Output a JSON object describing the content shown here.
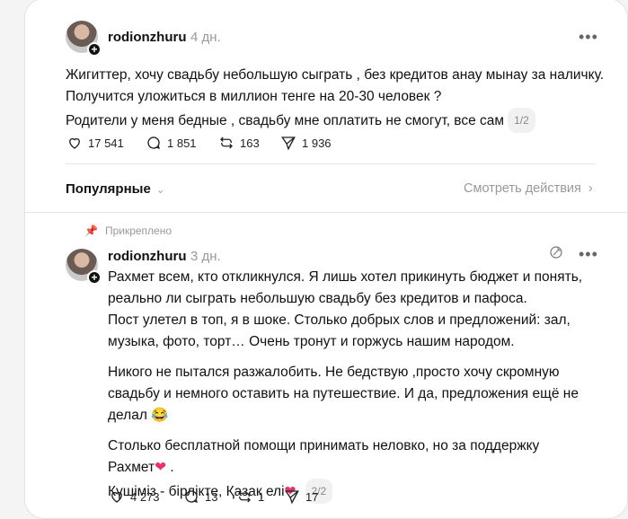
{
  "post": {
    "username": "rodionzhuru",
    "time": "4 дн.",
    "lines": [
      "Жигиттер, хочу свадьбу небольшую сыграть , без кредитов анау мынау за наличку.",
      "Получится уложиться в миллион тенге на 20-30 человек ?",
      "Родители у меня бедные , свадьбу мне оплатить не смогут, все сам"
    ],
    "page": "1/2",
    "likes": "17 541",
    "comments": "1 851",
    "reposts": "163",
    "shares": "1 936",
    "more": "•••"
  },
  "sort": {
    "label": "Популярные",
    "activity_link": "Смотреть действия"
  },
  "reply": {
    "pinned_label": "Прикреплено",
    "username": "rodionzhuru",
    "time": "3 дн.",
    "para1": [
      "Рахмет всем, кто откликнулся. Я лишь хотел прикинуть бюджет и понять,",
      "реально ли сыграть небольшую свадьбу без кредитов и пафоса.",
      "Пост улетел в топ, я в шоке. Столько добрых слов и предложений: зал,",
      "музыка, фото, торт… Очень тронут и горжусь нашим народом."
    ],
    "para2": [
      "Никого не пытался разжалобить. Не бедствую ,просто хочу скромную",
      "свадьбу и немного оставить на путешествие. И да, предложения ещё не",
      "делал"
    ],
    "para2_emoji": "😂",
    "para3": [
      "Столько бесплатной помощи принимать неловко, но за поддержку",
      "Рахмет",
      "Күшіміз - бірлікте, Қазақ елі"
    ],
    "heart_emoji": "❤",
    "page": "2/2",
    "likes": "4 273",
    "comments": "13",
    "reposts": "1",
    "shares": "17",
    "more": "•••"
  }
}
